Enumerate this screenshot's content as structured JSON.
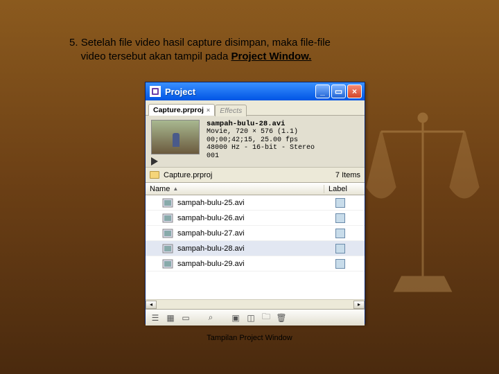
{
  "instruction": {
    "number": "5. ",
    "line1": "Setelah file video hasil capture disimpan, maka file-file",
    "line2": "video tersebut akan tampil pada ",
    "project_window": "Project Window."
  },
  "caption": "Tampilan Project Window",
  "window": {
    "title": "Project",
    "tabs": {
      "active": "Capture.prproj",
      "inactive": "Effects"
    },
    "preview": {
      "filename": "sampah-bulu-28.avi",
      "line1": "Movie, 720 × 576 (1.1)",
      "line2": "00;00;42;15, 25.00 fps",
      "line3": "48000 Hz - 16-bit - Stereo",
      "line4": "001"
    },
    "path": "Capture.prproj",
    "items_count": "7 Items",
    "columns": {
      "name": "Name",
      "label": "Label"
    },
    "files": [
      {
        "name": "sampah-bulu-25.avi",
        "selected": false
      },
      {
        "name": "sampah-bulu-26.avi",
        "selected": false
      },
      {
        "name": "sampah-bulu-27.avi",
        "selected": false
      },
      {
        "name": "sampah-bulu-28.avi",
        "selected": true
      },
      {
        "name": "sampah-bulu-29.avi",
        "selected": false
      }
    ]
  }
}
